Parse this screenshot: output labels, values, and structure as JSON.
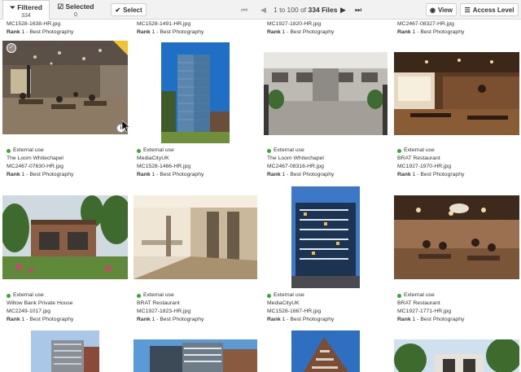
{
  "toolbar": {
    "filtered_label": "Filtered",
    "filtered_count": "334",
    "selected_label": "Selected",
    "selected_count": "0",
    "select_label": "Select",
    "view_label": "View",
    "access_label": "Access Level"
  },
  "pager": {
    "range_text": "1 to 100 of",
    "total_text": "334 Files",
    "first_icon": "first-page-icon",
    "prev_icon": "previous-page-icon",
    "next_icon": "next-page-icon",
    "last_icon": "last-page-icon"
  },
  "top_row": [
    {
      "file": "MC1528-1638-HR.jpg",
      "rank_label": "Rank",
      "rank_value": "1 - Best Photography"
    },
    {
      "file": "MC1528-1491-HR.jpg",
      "rank_label": "Rank",
      "rank_value": "1 - Best Photography"
    },
    {
      "file": "MC1927-1820-HR.jpg",
      "rank_label": "Rank",
      "rank_value": "1 - Best Photography"
    },
    {
      "file": "MC2467-08327-HR.jpg",
      "rank_label": "Rank",
      "rank_value": "1 - Best Photography"
    }
  ],
  "cards": [
    {
      "usage": "External use",
      "project": "The Loom Whitechapel",
      "file": "MC2467-07630-HR.jpg",
      "rank_label": "Rank",
      "rank_value": "1 - Best Photography"
    },
    {
      "usage": "External use",
      "project": "MediaCityUK",
      "file": "MC1528-1466-HR.jpg",
      "rank_label": "Rank",
      "rank_value": "1 - Best Photography"
    },
    {
      "usage": "External use",
      "project": "The Loom Whitechapel",
      "file": "MC2467-08316-HR.jpg",
      "rank_label": "Rank",
      "rank_value": "1 - Best Photography"
    },
    {
      "usage": "External use",
      "project": "BRAT Restaurant",
      "file": "MC1927-1970-HR.jpg",
      "rank_label": "Rank",
      "rank_value": "1 - Best Photography"
    },
    {
      "usage": "External use",
      "project": "Willow Bank Private House",
      "file": "MC2249-1017.jpg",
      "rank_label": "Rank",
      "rank_value": "1 - Best Photography"
    },
    {
      "usage": "External use",
      "project": "BRAT Restaurant",
      "file": "MC1927-1823-HR.jpg",
      "rank_label": "Rank",
      "rank_value": "1 - Best Photography"
    },
    {
      "usage": "External use",
      "project": "MediaCityUK",
      "file": "MC1528-1667-HR.jpg",
      "rank_label": "Rank",
      "rank_value": "1 - Best Photography"
    },
    {
      "usage": "External use",
      "project": "BRAT Restaurant",
      "file": "MC1927-1771-HR.jpg",
      "rank_label": "Rank",
      "rank_value": "1 - Best Photography"
    }
  ],
  "colors": {
    "usage_green": "#39a935",
    "accent_yellow": "#f2c230",
    "toolbar_bg": "#f2f2f2"
  }
}
